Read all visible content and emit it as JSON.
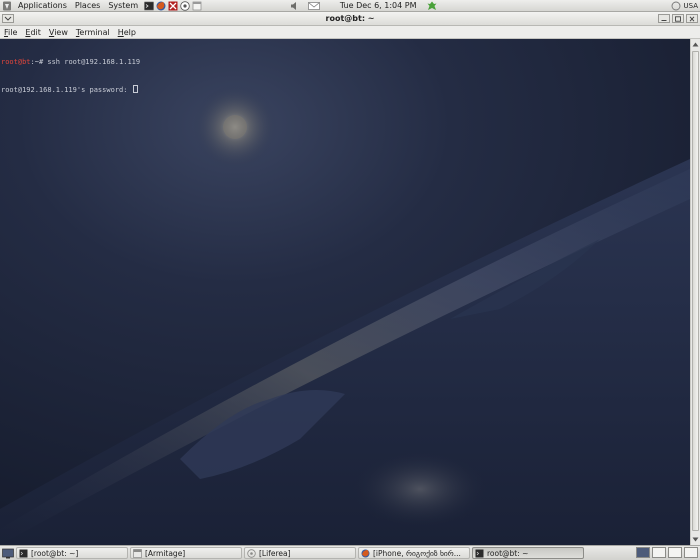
{
  "top_panel": {
    "menus": [
      "Applications",
      "Places",
      "System"
    ],
    "launchers": [
      {
        "icon": "terminal-icon",
        "color": "#2b2b2b"
      },
      {
        "icon": "firefox-icon",
        "color": "#d55a1f"
      },
      {
        "icon": "armitage-icon",
        "color": "#b22020"
      },
      {
        "icon": "network-icon",
        "color": "#555555"
      },
      {
        "icon": "window-icon",
        "color": "#9a9a9a"
      }
    ],
    "clock": "Tue Dec  6,  1:04 PM",
    "tray_icons": [
      "volume-icon",
      "mail-icon",
      "network-status-icon"
    ],
    "user": "USA"
  },
  "window": {
    "title": "root@bt: ~",
    "menus": [
      {
        "key": "F",
        "rest": "ile"
      },
      {
        "key": "E",
        "rest": "dit"
      },
      {
        "key": "V",
        "rest": "iew"
      },
      {
        "key": "T",
        "rest": "erminal"
      },
      {
        "key": "H",
        "rest": "elp"
      }
    ]
  },
  "terminal": {
    "line1_user": "root@bt",
    "line1_rest": ":~# ssh root@192.168.1.119",
    "line2": "root@192.168.1.119's password: "
  },
  "taskbar": {
    "tasks": [
      {
        "label": "[root@bt: ~]",
        "icon": "terminal-icon",
        "active": false
      },
      {
        "label": "[Armitage]",
        "icon": "armitage-window-icon",
        "active": false
      },
      {
        "label": "[Liferea]",
        "icon": "feed-reader-icon",
        "active": false
      },
      {
        "label": "[iPhone, რიგოქიზ ხირ...",
        "icon": "browser-icon",
        "active": false
      },
      {
        "label": "root@bt: ~",
        "icon": "terminal-icon",
        "active": true
      }
    ],
    "workspace_count": 4
  },
  "colors": {
    "prompt_user": "#e0463c",
    "terminal_text": "#c8ccd6",
    "panel_bg": "#e4e4e2"
  }
}
